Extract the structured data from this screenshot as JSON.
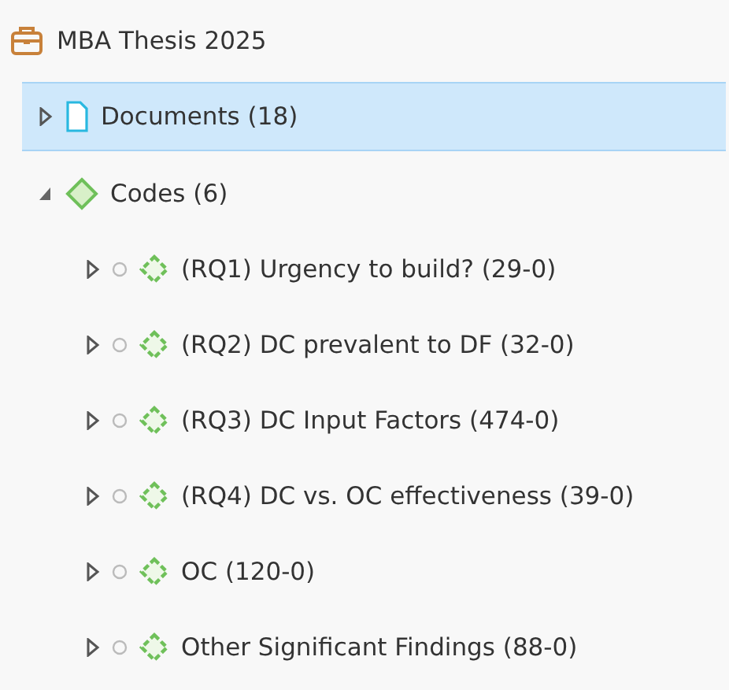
{
  "project": {
    "title": "MBA Thesis 2025"
  },
  "tree": [
    {
      "label": "Documents (18)",
      "kind": "document",
      "expanded": false,
      "selected": true
    },
    {
      "label": "Codes (6)",
      "kind": "codes",
      "expanded": true,
      "selected": false,
      "children": [
        {
          "label": "(RQ1) Urgency to build? (29-0)",
          "kind": "code",
          "expanded": false,
          "selected": false
        },
        {
          "label": "(RQ2) DC prevalent to DF (32-0)",
          "kind": "code",
          "expanded": false,
          "selected": false
        },
        {
          "label": "(RQ3) DC Input Factors (474-0)",
          "kind": "code",
          "expanded": false,
          "selected": false
        },
        {
          "label": "(RQ4) DC vs. OC effectiveness (39-0)",
          "kind": "code",
          "expanded": false,
          "selected": false
        },
        {
          "label": "OC (120-0)",
          "kind": "code",
          "expanded": false,
          "selected": false
        },
        {
          "label": "Other Significant Findings (88-0)",
          "kind": "code",
          "expanded": false,
          "selected": false
        }
      ]
    }
  ]
}
